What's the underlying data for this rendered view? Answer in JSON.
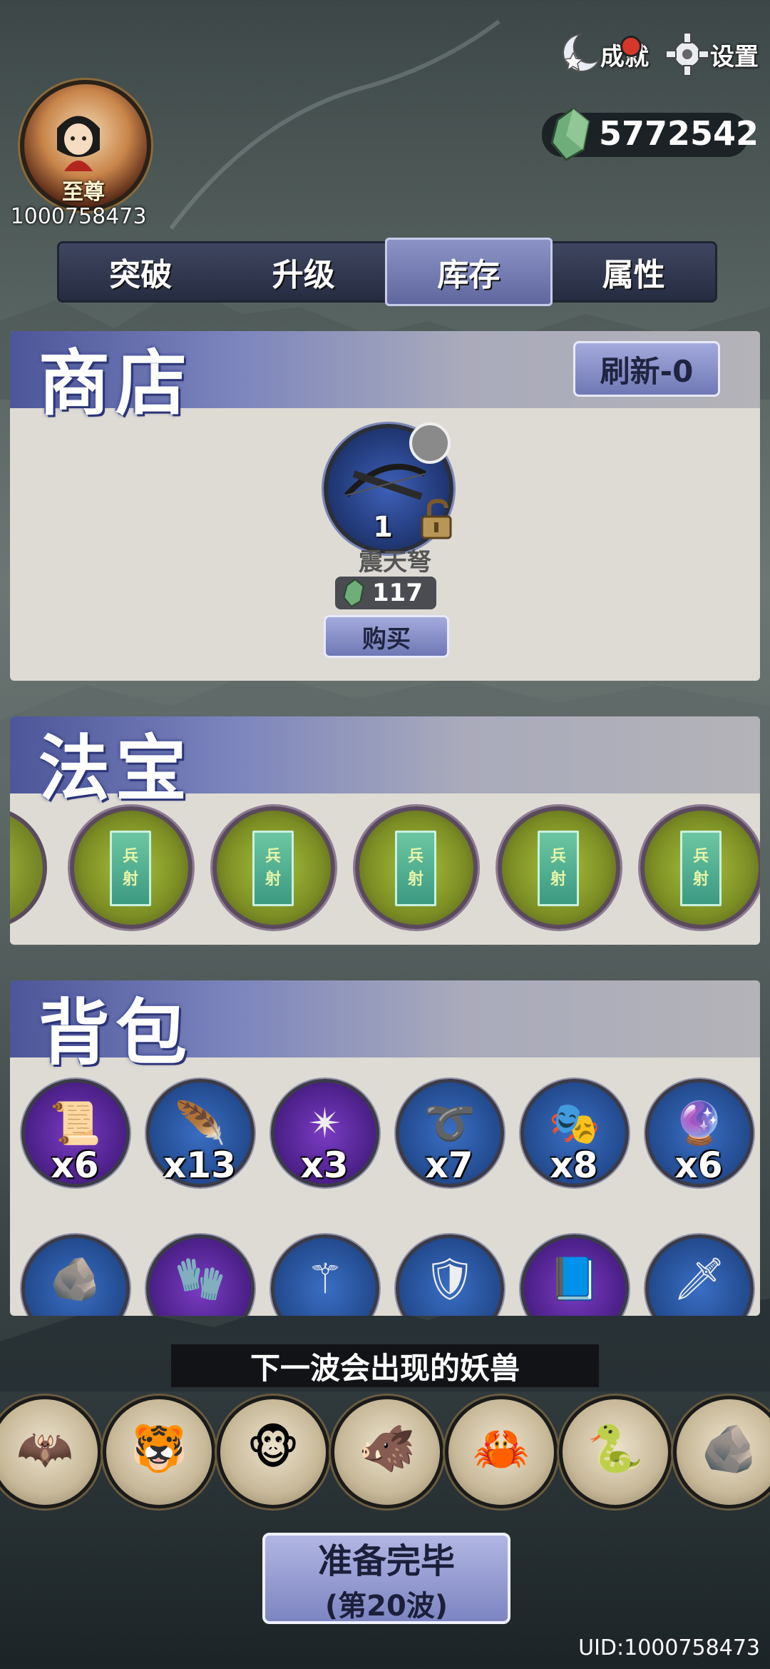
{
  "player": {
    "rank": "至尊",
    "id": "1000758473"
  },
  "top_buttons": {
    "achievement": "成就",
    "settings": "设置"
  },
  "currency": {
    "value": "5772542",
    "icon": "jade-crystal-icon"
  },
  "tabs": [
    {
      "label": "突破",
      "active": false
    },
    {
      "label": "升级",
      "active": false
    },
    {
      "label": "库存",
      "active": true
    },
    {
      "label": "属性",
      "active": false
    }
  ],
  "shop": {
    "title": "商店",
    "refresh_label": "刷新-0",
    "item": {
      "name": "震天弩",
      "level": "1",
      "price": "117",
      "buy_label": "购买",
      "icon": "crossbow-icon"
    }
  },
  "treasure": {
    "title": "法宝",
    "items": [
      {
        "line1": "兵",
        "line2": "射"
      },
      {
        "line1": "兵",
        "line2": "射"
      },
      {
        "line1": "兵",
        "line2": "射"
      },
      {
        "line1": "兵",
        "line2": "射"
      },
      {
        "line1": "兵",
        "line2": "射"
      }
    ]
  },
  "backpack": {
    "title": "背包",
    "items": [
      {
        "icon": "talisman-scroll-icon",
        "count": "x6",
        "bg": "purple"
      },
      {
        "icon": "feather-quill-icon",
        "count": "x13",
        "bg": "blue"
      },
      {
        "icon": "spiked-star-icon",
        "count": "x3",
        "bg": "purple"
      },
      {
        "icon": "whip-icon",
        "count": "x7",
        "bg": "blue"
      },
      {
        "icon": "mask-icon",
        "count": "x8",
        "bg": "blue"
      },
      {
        "icon": "pearl-icon",
        "count": "x6",
        "bg": "blue"
      }
    ],
    "row2": [
      {
        "icon": "stone-icon",
        "bg": "blue"
      },
      {
        "icon": "glove-icon",
        "bg": "purple"
      },
      {
        "icon": "staff-icon",
        "bg": "blue"
      },
      {
        "icon": "shield-icon",
        "bg": "blue"
      },
      {
        "icon": "book-icon",
        "bg": "purple"
      },
      {
        "icon": "dagger-icon",
        "bg": "blue"
      }
    ]
  },
  "next_wave": {
    "title": "下一波会出现的妖兽",
    "monsters": [
      "bat-monster-icon",
      "tiger-monster-icon",
      "monkey-monster-icon",
      "boar-monster-icon",
      "crab-monster-icon",
      "serpent-monster-icon",
      "rock-beast-icon"
    ]
  },
  "ready": {
    "label": "准备完毕",
    "wave": "(第20波)"
  },
  "uid": "UID:1000758473",
  "colors": {
    "accent": "#7c85bd",
    "panel": "#dedbd4",
    "purple_slot": "#5b2a9c",
    "blue_slot": "#2f5aa8"
  }
}
